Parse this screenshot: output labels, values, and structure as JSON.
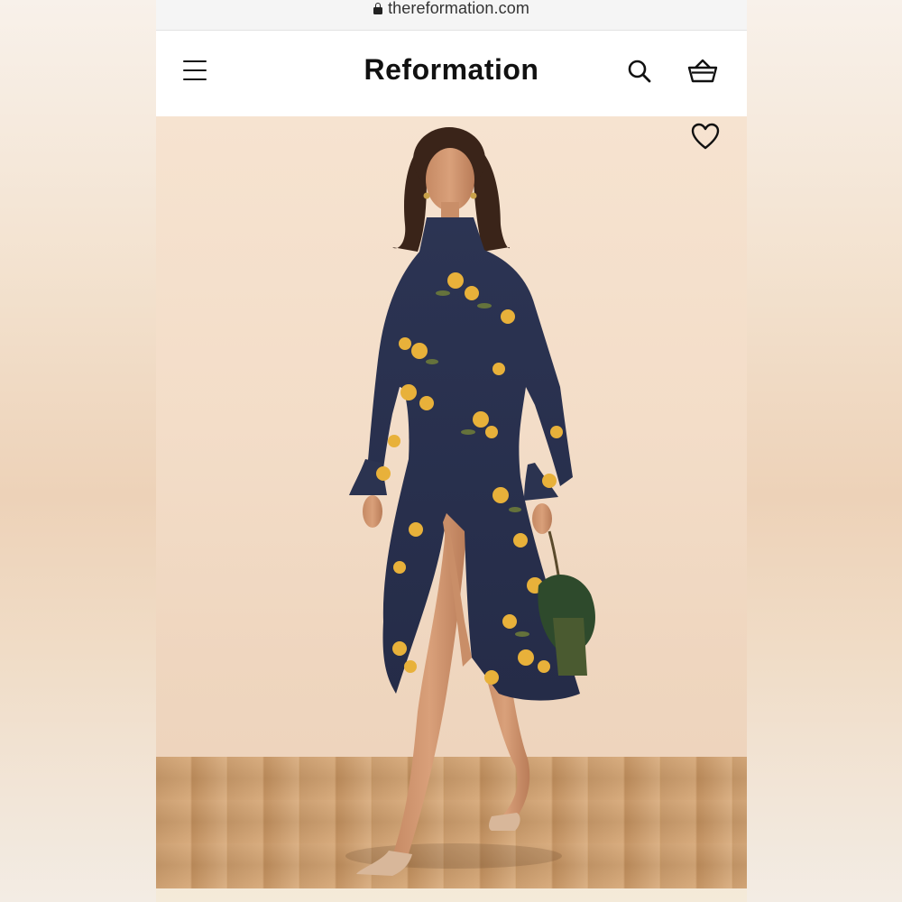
{
  "browser": {
    "url": "thereformation.com"
  },
  "header": {
    "logo": "Reformation",
    "menu_icon": "hamburger-menu-icon",
    "search_icon": "search-icon",
    "cart_icon": "basket-icon"
  },
  "product_image": {
    "favorite_icon": "heart-icon",
    "description": ""
  },
  "colors": {
    "header_bg": "#ffffff",
    "url_bar_bg": "#f5f5f5",
    "text": "#111111",
    "dress_navy": "#2b3350",
    "flower_yellow": "#e8b13a",
    "backdrop": "#f3ddc8",
    "floor_wood": "#c99a6a"
  }
}
